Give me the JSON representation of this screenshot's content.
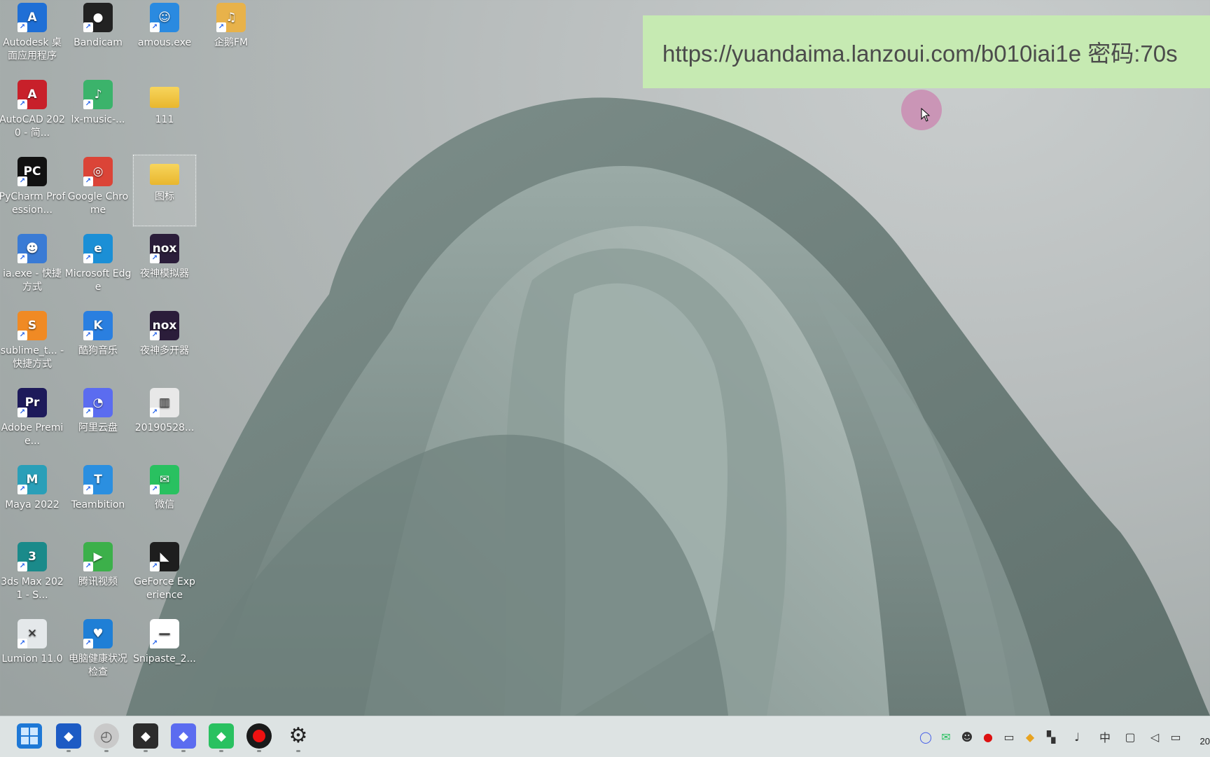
{
  "banner": {
    "text": "https://yuandaima.lanzoui.com/b010iai1e 密码:70s"
  },
  "desktop_icons": [
    {
      "label": "Autodesk 桌面应用程序",
      "icon": "autodesk-icon",
      "color": "#1f6fd6",
      "glyph": "A"
    },
    {
      "label": "Bandicam",
      "icon": "bandicam-icon",
      "color": "#222222",
      "glyph": "●"
    },
    {
      "label": "amous.exe",
      "icon": "doraemon-icon",
      "color": "#2a8ae0",
      "glyph": "☺"
    },
    {
      "label": "企鹅FM",
      "icon": "qiefm-icon",
      "color": "#e8b24a",
      "glyph": "♫"
    },
    {
      "label": "AutoCAD 2020 - 简...",
      "icon": "autocad-icon",
      "color": "#c8202a",
      "glyph": "A"
    },
    {
      "label": "lx-music-...",
      "icon": "lx-music-icon",
      "color": "#3bb36b",
      "glyph": "♪"
    },
    {
      "label": "111",
      "icon": "folder-icon",
      "color": "#f2c441",
      "glyph": ""
    },
    {
      "label": "PyCharm Profession...",
      "icon": "pycharm-icon",
      "color": "#111111",
      "glyph": "PC"
    },
    {
      "label": "Google Chrome",
      "icon": "chrome-icon",
      "color": "#db4437",
      "glyph": "◎"
    },
    {
      "label": "图标",
      "icon": "folder-icon",
      "color": "#f2c441",
      "glyph": ""
    },
    {
      "label": "ia.exe - 快捷方式",
      "icon": "ia-exe-icon",
      "color": "#3a7bd5",
      "glyph": "☻"
    },
    {
      "label": "Microsoft Edge",
      "icon": "edge-icon",
      "color": "#1b8fd6",
      "glyph": "e"
    },
    {
      "label": "夜神模拟器",
      "icon": "nox-icon",
      "color": "#2b1d3a",
      "glyph": "nox"
    },
    {
      "label": "sublime_t... - 快捷方式",
      "icon": "sublime-icon",
      "color": "#f08a24",
      "glyph": "S"
    },
    {
      "label": "酷狗音乐",
      "icon": "kugou-icon",
      "color": "#2a7fe0",
      "glyph": "K"
    },
    {
      "label": "夜神多开器",
      "icon": "nox-multi-icon",
      "color": "#2b1d3a",
      "glyph": "nox"
    },
    {
      "label": "Adobe Premie...",
      "icon": "premiere-icon",
      "color": "#1d1a5a",
      "glyph": "Pr"
    },
    {
      "label": "阿里云盘",
      "icon": "aliyun-drive-icon",
      "color": "#5b6cf0",
      "glyph": "◔"
    },
    {
      "label": "20190528...",
      "icon": "image-file-icon",
      "color": "#e8e8e8",
      "glyph": "▥"
    },
    {
      "label": "Maya 2022",
      "icon": "maya-icon",
      "color": "#2a9fb8",
      "glyph": "M"
    },
    {
      "label": "Teambition",
      "icon": "teambition-icon",
      "color": "#2b8fe0",
      "glyph": "T"
    },
    {
      "label": "微信",
      "icon": "wechat-icon",
      "color": "#29c160",
      "glyph": "✉"
    },
    {
      "label": "3ds Max 2021 - S...",
      "icon": "3dsmax-icon",
      "color": "#1a8a8a",
      "glyph": "3"
    },
    {
      "label": "腾讯视频",
      "icon": "tencent-video-icon",
      "color": "#3cb04a",
      "glyph": "▶"
    },
    {
      "label": "GeForce Experience",
      "icon": "geforce-icon",
      "color": "#1e1e1e",
      "glyph": "◣"
    },
    {
      "label": "Lumion 11.0",
      "icon": "lumion-icon",
      "color": "#e4e8ea",
      "glyph": "✕"
    },
    {
      "label": "电脑健康状况检查",
      "icon": "pc-health-icon",
      "color": "#1f7fd6",
      "glyph": "♥"
    },
    {
      "label": "Snipaste_2...",
      "icon": "snipaste-icon",
      "color": "#ffffff",
      "glyph": "—"
    }
  ],
  "taskbar": {
    "apps": [
      {
        "icon": "start-windows-icon",
        "color": "#1e78d6"
      },
      {
        "icon": "autodesk-app-icon",
        "color": "#1d5bc4"
      },
      {
        "icon": "clock-app-icon",
        "color": "#c9c9c9"
      },
      {
        "icon": "nvidia-app-icon",
        "color": "#2c2c2c"
      },
      {
        "icon": "aliyun-app-icon",
        "color": "#5b6cf0"
      },
      {
        "icon": "wechat-app-icon",
        "color": "#29c160"
      },
      {
        "icon": "record-app-icon",
        "color": "#1a1a1a"
      },
      {
        "icon": "settings-app-icon",
        "color": "#333333"
      }
    ],
    "tray": [
      {
        "icon": "aliyun-tray-icon",
        "glyph": "◯"
      },
      {
        "icon": "wechat-tray-icon",
        "glyph": "✉"
      },
      {
        "icon": "penguin-tray-icon",
        "glyph": "☻"
      },
      {
        "icon": "record-tray-icon",
        "glyph": "●"
      },
      {
        "icon": "window-tray-icon",
        "glyph": "▭"
      },
      {
        "icon": "shield-tray-icon",
        "glyph": "◆"
      },
      {
        "icon": "bookmark-tray-icon",
        "glyph": "▚"
      },
      {
        "icon": "microphone-tray-icon",
        "glyph": "♩"
      },
      {
        "icon": "ime-indicator",
        "glyph": "中"
      },
      {
        "icon": "network-tray-icon",
        "glyph": "▢"
      },
      {
        "icon": "volume-tray-icon",
        "glyph": "◁"
      },
      {
        "icon": "battery-tray-icon",
        "glyph": "▭"
      }
    ],
    "clock_fragment": "20"
  }
}
